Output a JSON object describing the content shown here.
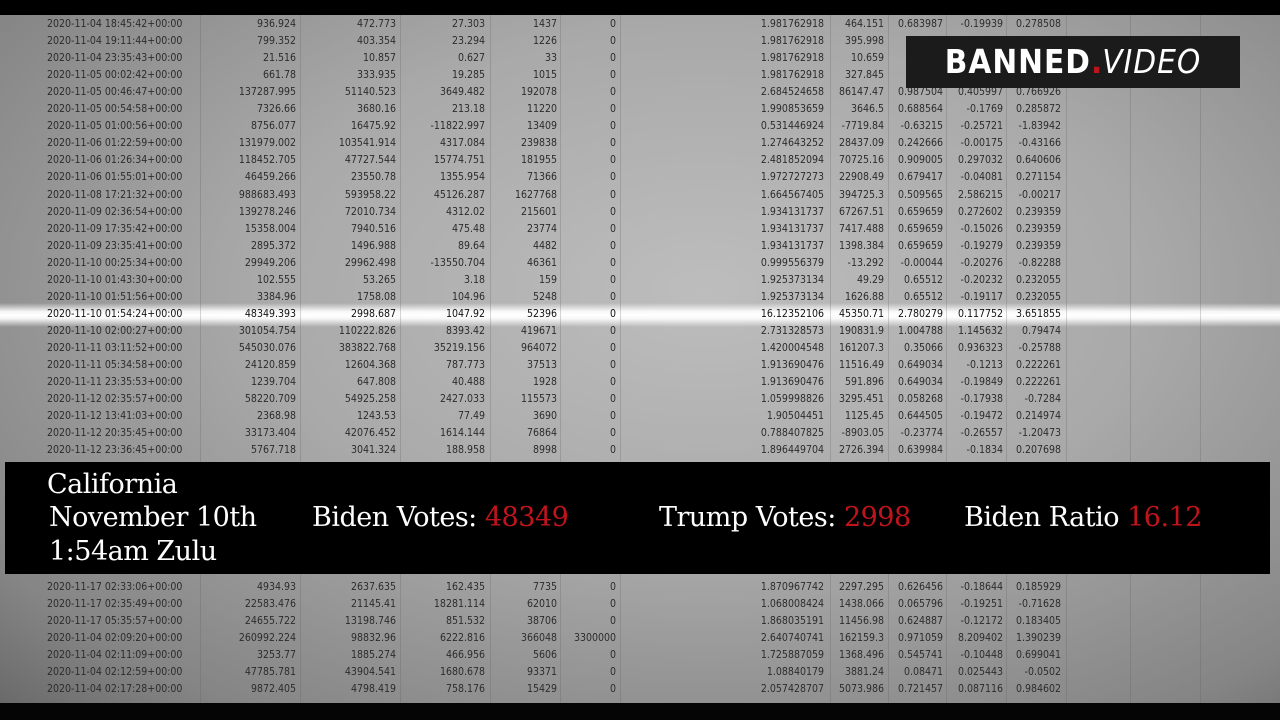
{
  "logo": {
    "part1": "BANNED",
    "dot": ".",
    "part2": "VIDEO"
  },
  "caption": {
    "state": "California",
    "date": "November 10th",
    "time": "1:54am Zulu",
    "biden_label": "Biden Votes:",
    "biden_value": "48349",
    "trump_label": "Trump Votes:",
    "trump_value": "2998",
    "ratio_label": "Biden Ratio",
    "ratio_value": "16.12",
    "highlight_color": "#c0141c"
  },
  "highlighted_row_timestamp": "2020-11-10 01:54:24+00:00",
  "rows_top": [
    [
      "2020-11-04 18:45:42+00:00",
      "936.924",
      "472.773",
      "27.303",
      "1437",
      "0",
      "1.981762918",
      "464.151",
      "0.683987",
      "-0.19939",
      "0.278508"
    ],
    [
      "2020-11-04 19:11:44+00:00",
      "799.352",
      "403.354",
      "23.294",
      "1226",
      "0",
      "1.981762918",
      "395.998",
      "0.6",
      "",
      ""
    ],
    [
      "2020-11-04 23:35:43+00:00",
      "21.516",
      "10.857",
      "0.627",
      "33",
      "0",
      "1.981762918",
      "10.659",
      "0.6",
      "",
      ""
    ],
    [
      "2020-11-05 00:02:42+00:00",
      "661.78",
      "333.935",
      "19.285",
      "1015",
      "0",
      "1.981762918",
      "327.845",
      "0.6",
      "",
      ""
    ],
    [
      "2020-11-05 00:46:47+00:00",
      "137287.995",
      "51140.523",
      "3649.482",
      "192078",
      "0",
      "2.684524658",
      "86147.47",
      "0.987504",
      "0.405997",
      "0.766926"
    ],
    [
      "2020-11-05 00:54:58+00:00",
      "7326.66",
      "3680.16",
      "213.18",
      "11220",
      "0",
      "1.990853659",
      "3646.5",
      "0.688564",
      "-0.1769",
      "0.285872"
    ],
    [
      "2020-11-05 01:00:56+00:00",
      "8756.077",
      "16475.92",
      "-11822.997",
      "13409",
      "0",
      "0.531446924",
      "-7719.84",
      "-0.63215",
      "-0.25721",
      "-1.83942"
    ],
    [
      "2020-11-06 01:22:59+00:00",
      "131979.002",
      "103541.914",
      "4317.084",
      "239838",
      "0",
      "1.274643252",
      "28437.09",
      "0.242666",
      "-0.00175",
      "-0.43166"
    ],
    [
      "2020-11-06 01:26:34+00:00",
      "118452.705",
      "47727.544",
      "15774.751",
      "181955",
      "0",
      "2.481852094",
      "70725.16",
      "0.909005",
      "0.297032",
      "0.640606"
    ],
    [
      "2020-11-06 01:55:01+00:00",
      "46459.266",
      "23550.78",
      "1355.954",
      "71366",
      "0",
      "1.972727273",
      "22908.49",
      "0.679417",
      "-0.04081",
      "0.271154"
    ],
    [
      "2020-11-08 17:21:32+00:00",
      "988683.493",
      "593958.22",
      "45126.287",
      "1627768",
      "0",
      "1.664567405",
      "394725.3",
      "0.509565",
      "2.586215",
      "-0.00217"
    ],
    [
      "2020-11-09 02:36:54+00:00",
      "139278.246",
      "72010.734",
      "4312.02",
      "215601",
      "0",
      "1.934131737",
      "67267.51",
      "0.659659",
      "0.272602",
      "0.239359"
    ],
    [
      "2020-11-09 17:35:42+00:00",
      "15358.004",
      "7940.516",
      "475.48",
      "23774",
      "0",
      "1.934131737",
      "7417.488",
      "0.659659",
      "-0.15026",
      "0.239359"
    ],
    [
      "2020-11-09 23:35:41+00:00",
      "2895.372",
      "1496.988",
      "89.64",
      "4482",
      "0",
      "1.934131737",
      "1398.384",
      "0.659659",
      "-0.19279",
      "0.239359"
    ],
    [
      "2020-11-10 00:25:34+00:00",
      "29949.206",
      "29962.498",
      "-13550.704",
      "46361",
      "0",
      "0.999556379",
      "-13.292",
      "-0.00044",
      "-0.20276",
      "-0.82288"
    ],
    [
      "2020-11-10 01:43:30+00:00",
      "102.555",
      "53.265",
      "3.18",
      "159",
      "0",
      "1.925373134",
      "49.29",
      "0.65512",
      "-0.20232",
      "0.232055"
    ],
    [
      "2020-11-10 01:51:56+00:00",
      "3384.96",
      "1758.08",
      "104.96",
      "5248",
      "0",
      "1.925373134",
      "1626.88",
      "0.65512",
      "-0.19117",
      "0.232055"
    ],
    [
      "2020-11-10 01:54:24+00:00",
      "48349.393",
      "2998.687",
      "1047.92",
      "52396",
      "0",
      "16.12352106",
      "45350.71",
      "2.780279",
      "0.117752",
      "3.651855"
    ],
    [
      "2020-11-10 02:00:27+00:00",
      "301054.754",
      "110222.826",
      "8393.42",
      "419671",
      "0",
      "2.731328573",
      "190831.9",
      "1.004788",
      "1.145632",
      "0.79474"
    ],
    [
      "2020-11-11 03:11:52+00:00",
      "545030.076",
      "383822.768",
      "35219.156",
      "964072",
      "0",
      "1.420004548",
      "161207.3",
      "0.35066",
      "0.936323",
      "-0.25788"
    ],
    [
      "2020-11-11 05:34:58+00:00",
      "24120.859",
      "12604.368",
      "787.773",
      "37513",
      "0",
      "1.913690476",
      "11516.49",
      "0.649034",
      "-0.1213",
      "0.222261"
    ],
    [
      "2020-11-11 23:35:53+00:00",
      "1239.704",
      "647.808",
      "40.488",
      "1928",
      "0",
      "1.913690476",
      "591.896",
      "0.649034",
      "-0.19849",
      "0.222261"
    ],
    [
      "2020-11-12 02:35:57+00:00",
      "58220.709",
      "54925.258",
      "2427.033",
      "115573",
      "0",
      "1.059998826",
      "3295.451",
      "0.058268",
      "-0.17938",
      "-0.7284"
    ],
    [
      "2020-11-12 13:41:03+00:00",
      "2368.98",
      "1243.53",
      "77.49",
      "3690",
      "0",
      "1.90504451",
      "1125.45",
      "0.644505",
      "-0.19472",
      "0.214974"
    ],
    [
      "2020-11-12 20:35:45+00:00",
      "33173.404",
      "42076.452",
      "1614.144",
      "76864",
      "0",
      "0.788407825",
      "-8903.05",
      "-0.23774",
      "-0.26557",
      "-1.20473"
    ],
    [
      "2020-11-12 23:36:45+00:00",
      "5767.718",
      "3041.324",
      "188.958",
      "8998",
      "0",
      "1.896449704",
      "2726.394",
      "0.639984",
      "-0.1834",
      "0.207698"
    ]
  ],
  "rows_bottom": [
    [
      "2020-11-17 02:33:06+00:00",
      "4934.93",
      "2637.635",
      "162.435",
      "7735",
      "0",
      "1.870967742",
      "2297.295",
      "0.626456",
      "-0.18644",
      "0.185929"
    ],
    [
      "2020-11-17 02:35:49+00:00",
      "22583.476",
      "21145.41",
      "18281.114",
      "62010",
      "0",
      "1.068008424",
      "1438.066",
      "0.065796",
      "-0.19251",
      "-0.71628"
    ],
    [
      "2020-11-17 05:35:57+00:00",
      "24655.722",
      "13198.746",
      "851.532",
      "38706",
      "0",
      "1.868035191",
      "11456.98",
      "0.624887",
      "-0.12172",
      "0.183405"
    ],
    [
      "2020-11-04 02:09:20+00:00",
      "260992.224",
      "98832.96",
      "6222.816",
      "366048",
      "3300000",
      "2.640740741",
      "162159.3",
      "0.971059",
      "8.209402",
      "1.390239"
    ],
    [
      "2020-11-04 02:11:09+00:00",
      "3253.77",
      "1885.274",
      "466.956",
      "5606",
      "0",
      "1.725887059",
      "1368.496",
      "0.545741",
      "-0.10448",
      "0.699041"
    ],
    [
      "2020-11-04 02:12:59+00:00",
      "47785.781",
      "43904.541",
      "1680.678",
      "93371",
      "0",
      "1.08840179",
      "3881.24",
      "0.08471",
      "0.025443",
      "-0.0502"
    ],
    [
      "2020-11-04 02:17:28+00:00",
      "9872.405",
      "4798.419",
      "758.176",
      "15429",
      "0",
      "2.057428707",
      "5073.986",
      "0.721457",
      "0.087116",
      "0.984602"
    ]
  ]
}
